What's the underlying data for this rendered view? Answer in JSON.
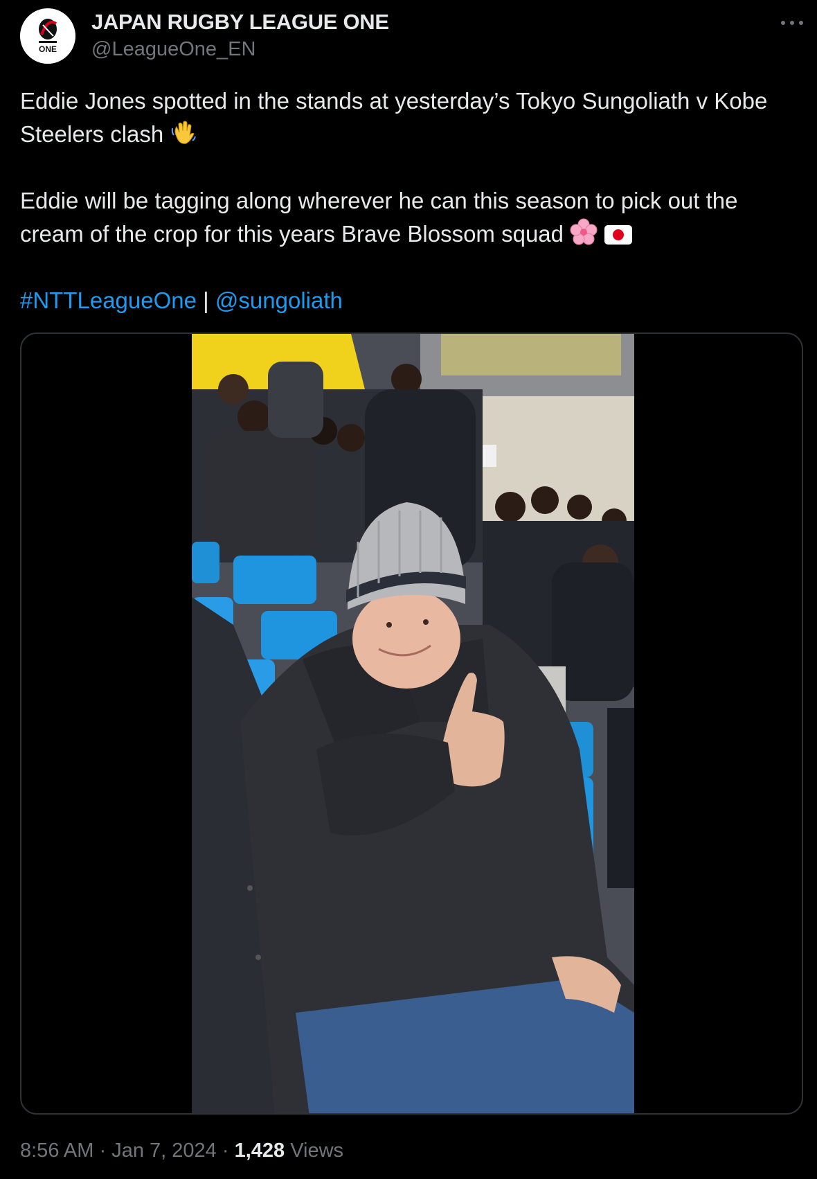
{
  "tweet": {
    "author": {
      "display_name": "JAPAN RUGBY LEAGUE ONE",
      "handle": "@LeagueOne_EN",
      "avatar_logo_text": "ONE"
    },
    "text": {
      "line1": "Eddie Jones spotted in the stands at yesterday’s Tokyo Sungoliath v Kobe Steelers clash",
      "line2": "Eddie will be tagging along wherever he can this season to pick out the cream of the crop for this years Brave Blossom squad",
      "hashtag": "#NTTLeagueOne",
      "separator": "|",
      "mention": "@sungoliath"
    },
    "icons": {
      "wave": "waving-hand-emoji",
      "blossom": "cherry-blossom-emoji",
      "flag": "japan-flag-emoji"
    },
    "meta": {
      "time": "8:56 AM",
      "sep1": "·",
      "date": "Jan 7, 2024",
      "sep2": "·",
      "views_count": "1,428",
      "views_label": "Views"
    }
  }
}
